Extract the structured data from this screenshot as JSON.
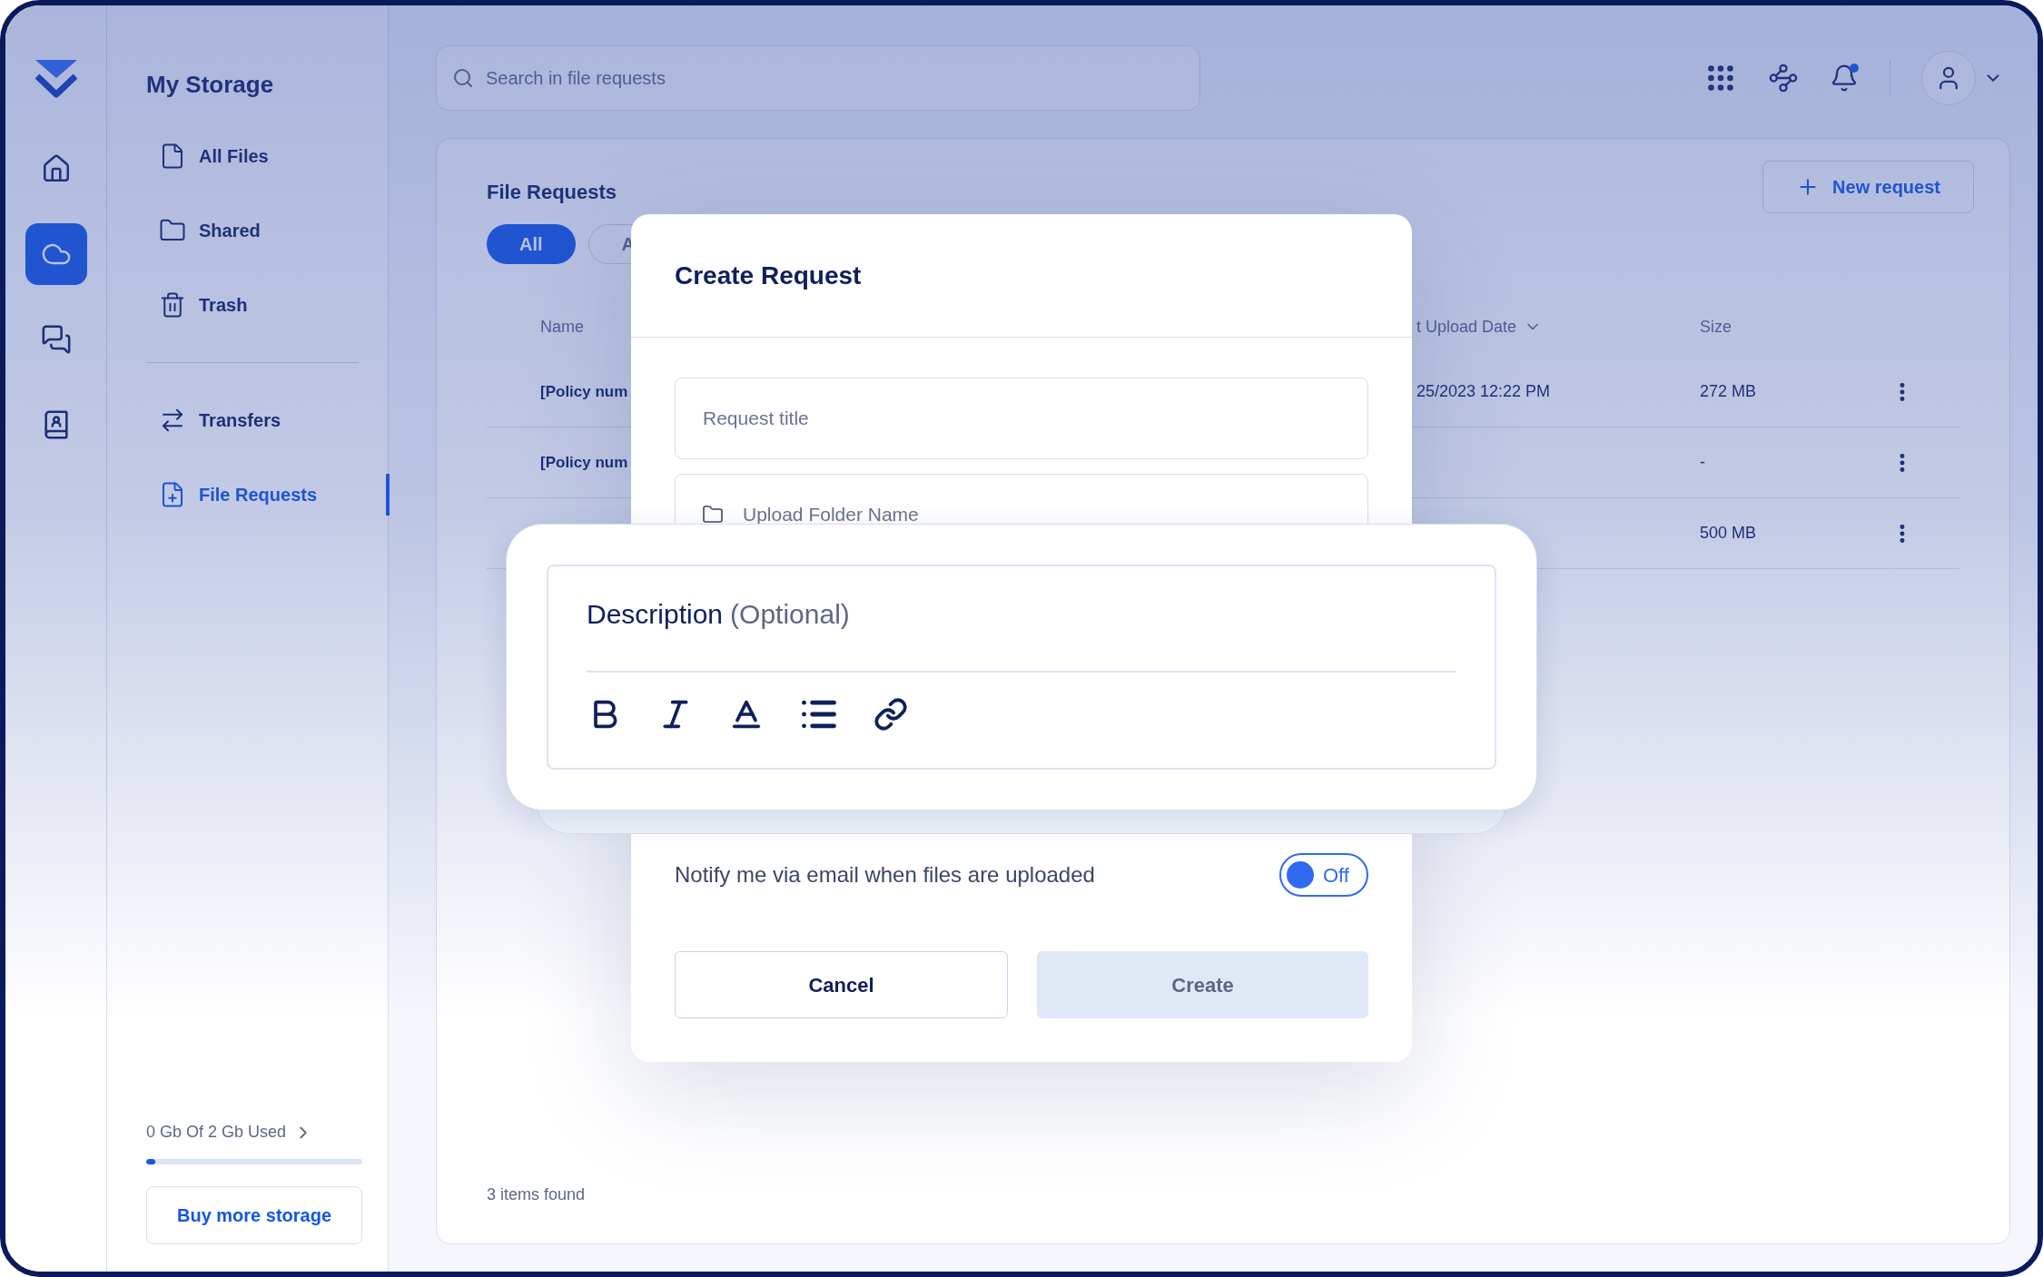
{
  "rail": {
    "items": [
      {
        "selected": false
      },
      {
        "selected": true
      },
      {
        "selected": false
      },
      {
        "selected": false
      }
    ]
  },
  "sidebar": {
    "title": "My Storage",
    "groups": [
      [
        {
          "label": "All Files",
          "selected": false
        },
        {
          "label": "Shared",
          "selected": false
        },
        {
          "label": "Trash",
          "selected": false
        }
      ],
      [
        {
          "label": "Transfers",
          "selected": false
        },
        {
          "label": "File Requests",
          "selected": true
        }
      ]
    ],
    "storage": {
      "text": "0 Gb Of 2 Gb Used",
      "level": 0.04
    },
    "buy_button": "Buy more storage"
  },
  "search": {
    "placeholder": "Search in file requests"
  },
  "page": {
    "title": "File Requests",
    "new_button": "New request",
    "filters": [
      {
        "label": "All",
        "selected": true
      },
      {
        "label": "A",
        "selected": false
      }
    ],
    "table": {
      "columns": [
        "Name",
        "t Upload Date",
        "Size"
      ],
      "rows": [
        {
          "name": "[Policy num",
          "date": "25/2023 12:22 PM",
          "size": "272 MB"
        },
        {
          "name": "[Policy num",
          "size": "-"
        },
        {
          "size": "500 MB"
        }
      ]
    },
    "footer": "3 items found"
  },
  "dialog": {
    "title": "Create Request",
    "fields": [
      {
        "placeholder": "Request title",
        "kind": "text"
      },
      {
        "placeholder": "Upload Folder Name",
        "kind": "folder"
      }
    ],
    "description": {
      "label": "Description",
      "hint": "(Optional)"
    },
    "notify": {
      "label": "Notify me via email when files are uploaded",
      "on": false,
      "state_text": "Off"
    },
    "buttons": [
      {
        "label": "Cancel",
        "kind": "secondary",
        "disabled": false
      },
      {
        "label": "Create",
        "kind": "primary",
        "disabled": true
      }
    ]
  }
}
